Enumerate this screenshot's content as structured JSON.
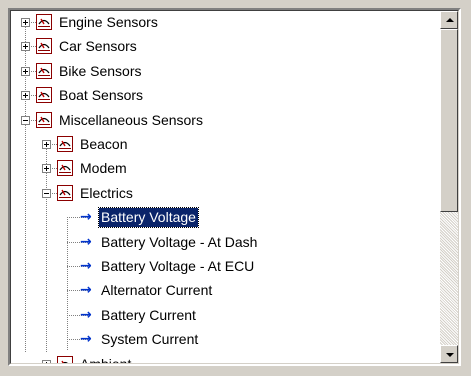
{
  "tree": {
    "items": [
      {
        "label": "Engine Sensors",
        "expander": "plus",
        "icon": "gauge-icon",
        "level": 0
      },
      {
        "label": "Car Sensors",
        "expander": "plus",
        "icon": "gauge-icon",
        "level": 0
      },
      {
        "label": "Bike Sensors",
        "expander": "plus",
        "icon": "gauge-icon",
        "level": 0
      },
      {
        "label": "Boat Sensors",
        "expander": "plus",
        "icon": "gauge-icon",
        "level": 0
      },
      {
        "label": "Miscellaneous Sensors",
        "expander": "minus",
        "icon": "gauge-icon",
        "level": 0
      },
      {
        "label": "Beacon",
        "expander": "plus",
        "icon": "gauge-icon",
        "level": 1
      },
      {
        "label": "Modem",
        "expander": "plus",
        "icon": "gauge-icon",
        "level": 1
      },
      {
        "label": "Electrics",
        "expander": "minus",
        "icon": "gauge-icon",
        "level": 1
      },
      {
        "label": "Battery Voltage",
        "icon": "arrow-right-icon",
        "level": 2,
        "selected": true
      },
      {
        "label": "Battery Voltage - At Dash",
        "icon": "arrow-right-icon",
        "level": 2
      },
      {
        "label": "Battery Voltage - At ECU",
        "icon": "arrow-right-icon",
        "level": 2
      },
      {
        "label": "Alternator Current",
        "icon": "arrow-right-icon",
        "level": 2
      },
      {
        "label": "Battery Current",
        "icon": "arrow-right-icon",
        "level": 2
      },
      {
        "label": "System Current",
        "icon": "arrow-right-icon",
        "level": 2
      },
      {
        "label": "Ambient",
        "expander": "plus",
        "icon": "gauge-icon",
        "level": 1
      }
    ]
  },
  "scrollbar": {
    "position": 0.0,
    "visible_fraction": 0.58
  },
  "colors": {
    "selection": "#0a246a",
    "arrow": "#0033cc",
    "gauge_border": "#8b0000"
  }
}
